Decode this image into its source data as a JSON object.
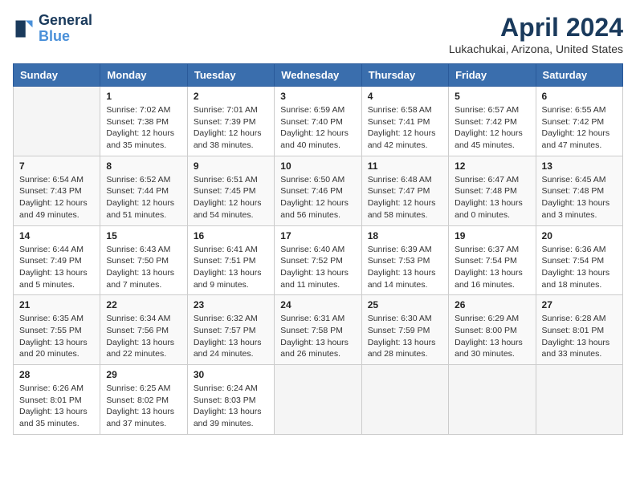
{
  "header": {
    "logo_line1": "General",
    "logo_line2": "Blue",
    "month_title": "April 2024",
    "location": "Lukachukai, Arizona, United States"
  },
  "weekdays": [
    "Sunday",
    "Monday",
    "Tuesday",
    "Wednesday",
    "Thursday",
    "Friday",
    "Saturday"
  ],
  "weeks": [
    [
      {
        "day": "",
        "empty": true
      },
      {
        "day": "1",
        "sunrise": "Sunrise: 7:02 AM",
        "sunset": "Sunset: 7:38 PM",
        "daylight": "Daylight: 12 hours and 35 minutes."
      },
      {
        "day": "2",
        "sunrise": "Sunrise: 7:01 AM",
        "sunset": "Sunset: 7:39 PM",
        "daylight": "Daylight: 12 hours and 38 minutes."
      },
      {
        "day": "3",
        "sunrise": "Sunrise: 6:59 AM",
        "sunset": "Sunset: 7:40 PM",
        "daylight": "Daylight: 12 hours and 40 minutes."
      },
      {
        "day": "4",
        "sunrise": "Sunrise: 6:58 AM",
        "sunset": "Sunset: 7:41 PM",
        "daylight": "Daylight: 12 hours and 42 minutes."
      },
      {
        "day": "5",
        "sunrise": "Sunrise: 6:57 AM",
        "sunset": "Sunset: 7:42 PM",
        "daylight": "Daylight: 12 hours and 45 minutes."
      },
      {
        "day": "6",
        "sunrise": "Sunrise: 6:55 AM",
        "sunset": "Sunset: 7:42 PM",
        "daylight": "Daylight: 12 hours and 47 minutes."
      }
    ],
    [
      {
        "day": "7",
        "sunrise": "Sunrise: 6:54 AM",
        "sunset": "Sunset: 7:43 PM",
        "daylight": "Daylight: 12 hours and 49 minutes."
      },
      {
        "day": "8",
        "sunrise": "Sunrise: 6:52 AM",
        "sunset": "Sunset: 7:44 PM",
        "daylight": "Daylight: 12 hours and 51 minutes."
      },
      {
        "day": "9",
        "sunrise": "Sunrise: 6:51 AM",
        "sunset": "Sunset: 7:45 PM",
        "daylight": "Daylight: 12 hours and 54 minutes."
      },
      {
        "day": "10",
        "sunrise": "Sunrise: 6:50 AM",
        "sunset": "Sunset: 7:46 PM",
        "daylight": "Daylight: 12 hours and 56 minutes."
      },
      {
        "day": "11",
        "sunrise": "Sunrise: 6:48 AM",
        "sunset": "Sunset: 7:47 PM",
        "daylight": "Daylight: 12 hours and 58 minutes."
      },
      {
        "day": "12",
        "sunrise": "Sunrise: 6:47 AM",
        "sunset": "Sunset: 7:48 PM",
        "daylight": "Daylight: 13 hours and 0 minutes."
      },
      {
        "day": "13",
        "sunrise": "Sunrise: 6:45 AM",
        "sunset": "Sunset: 7:48 PM",
        "daylight": "Daylight: 13 hours and 3 minutes."
      }
    ],
    [
      {
        "day": "14",
        "sunrise": "Sunrise: 6:44 AM",
        "sunset": "Sunset: 7:49 PM",
        "daylight": "Daylight: 13 hours and 5 minutes."
      },
      {
        "day": "15",
        "sunrise": "Sunrise: 6:43 AM",
        "sunset": "Sunset: 7:50 PM",
        "daylight": "Daylight: 13 hours and 7 minutes."
      },
      {
        "day": "16",
        "sunrise": "Sunrise: 6:41 AM",
        "sunset": "Sunset: 7:51 PM",
        "daylight": "Daylight: 13 hours and 9 minutes."
      },
      {
        "day": "17",
        "sunrise": "Sunrise: 6:40 AM",
        "sunset": "Sunset: 7:52 PM",
        "daylight": "Daylight: 13 hours and 11 minutes."
      },
      {
        "day": "18",
        "sunrise": "Sunrise: 6:39 AM",
        "sunset": "Sunset: 7:53 PM",
        "daylight": "Daylight: 13 hours and 14 minutes."
      },
      {
        "day": "19",
        "sunrise": "Sunrise: 6:37 AM",
        "sunset": "Sunset: 7:54 PM",
        "daylight": "Daylight: 13 hours and 16 minutes."
      },
      {
        "day": "20",
        "sunrise": "Sunrise: 6:36 AM",
        "sunset": "Sunset: 7:54 PM",
        "daylight": "Daylight: 13 hours and 18 minutes."
      }
    ],
    [
      {
        "day": "21",
        "sunrise": "Sunrise: 6:35 AM",
        "sunset": "Sunset: 7:55 PM",
        "daylight": "Daylight: 13 hours and 20 minutes."
      },
      {
        "day": "22",
        "sunrise": "Sunrise: 6:34 AM",
        "sunset": "Sunset: 7:56 PM",
        "daylight": "Daylight: 13 hours and 22 minutes."
      },
      {
        "day": "23",
        "sunrise": "Sunrise: 6:32 AM",
        "sunset": "Sunset: 7:57 PM",
        "daylight": "Daylight: 13 hours and 24 minutes."
      },
      {
        "day": "24",
        "sunrise": "Sunrise: 6:31 AM",
        "sunset": "Sunset: 7:58 PM",
        "daylight": "Daylight: 13 hours and 26 minutes."
      },
      {
        "day": "25",
        "sunrise": "Sunrise: 6:30 AM",
        "sunset": "Sunset: 7:59 PM",
        "daylight": "Daylight: 13 hours and 28 minutes."
      },
      {
        "day": "26",
        "sunrise": "Sunrise: 6:29 AM",
        "sunset": "Sunset: 8:00 PM",
        "daylight": "Daylight: 13 hours and 30 minutes."
      },
      {
        "day": "27",
        "sunrise": "Sunrise: 6:28 AM",
        "sunset": "Sunset: 8:01 PM",
        "daylight": "Daylight: 13 hours and 33 minutes."
      }
    ],
    [
      {
        "day": "28",
        "sunrise": "Sunrise: 6:26 AM",
        "sunset": "Sunset: 8:01 PM",
        "daylight": "Daylight: 13 hours and 35 minutes."
      },
      {
        "day": "29",
        "sunrise": "Sunrise: 6:25 AM",
        "sunset": "Sunset: 8:02 PM",
        "daylight": "Daylight: 13 hours and 37 minutes."
      },
      {
        "day": "30",
        "sunrise": "Sunrise: 6:24 AM",
        "sunset": "Sunset: 8:03 PM",
        "daylight": "Daylight: 13 hours and 39 minutes."
      },
      {
        "day": "",
        "empty": true
      },
      {
        "day": "",
        "empty": true
      },
      {
        "day": "",
        "empty": true
      },
      {
        "day": "",
        "empty": true
      }
    ]
  ]
}
